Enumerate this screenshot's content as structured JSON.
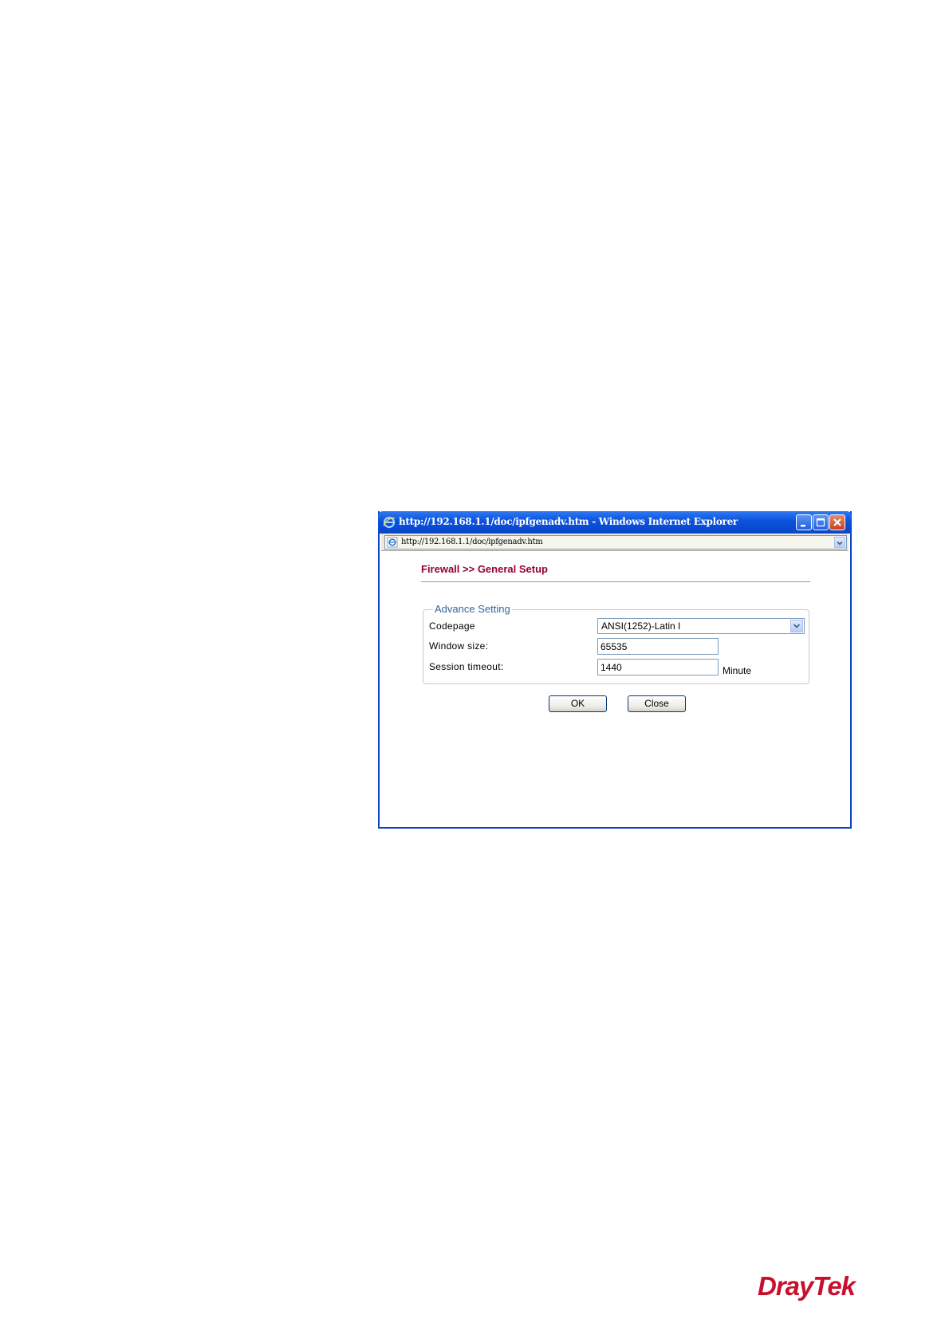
{
  "window": {
    "title": "http://192.168.1.1/doc/ipfgenadv.htm - Windows Internet Explorer",
    "address": "http://192.168.1.1/doc/ipfgenadv.htm"
  },
  "page": {
    "title": "Firewall >> General Setup",
    "section_legend": "Advance Setting",
    "fields": {
      "codepage_label": "Codepage",
      "codepage_value": "ANSI(1252)-Latin I",
      "window_size_label": "Window size:",
      "window_size_value": "65535",
      "session_timeout_label": "Session timeout:",
      "session_timeout_value": "1440",
      "session_timeout_unit": "Minute"
    },
    "buttons": {
      "ok": "OK",
      "close": "Close"
    }
  },
  "brand": {
    "logo_text": "DrayTek",
    "color": "#c8102e"
  },
  "colors": {
    "title_bar": "#0a52dc",
    "page_title": "#990033",
    "legend": "#336699"
  }
}
